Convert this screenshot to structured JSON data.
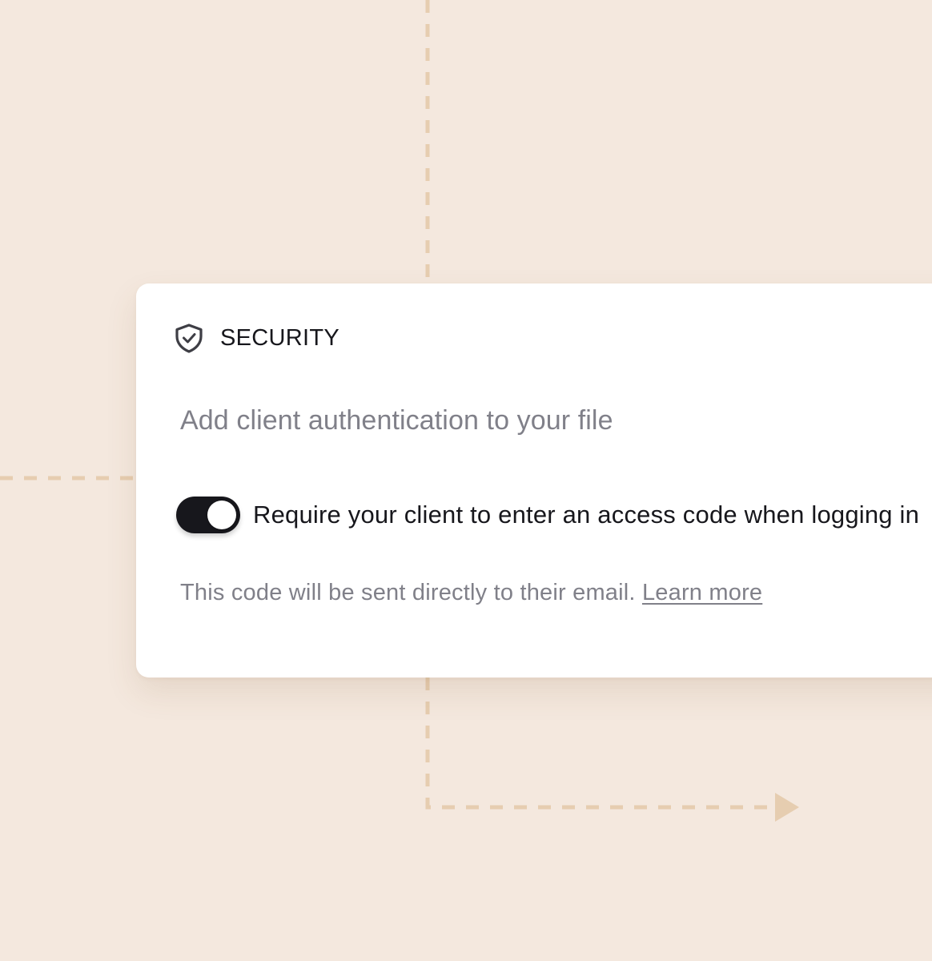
{
  "colors": {
    "background": "#f4e8de",
    "connector": "#e6cdb0",
    "card": "#ffffff",
    "toggle_on": "#17171c",
    "text_primary": "#17171c",
    "text_muted": "#808089"
  },
  "security": {
    "icon": "shield-check-icon",
    "title": "SECURITY",
    "subtitle": "Add client authentication to your file",
    "access_code_toggle": {
      "checked": true,
      "label": "Require your client to enter an access code when logging in"
    },
    "helper_text": "This code will be sent directly to their email.",
    "learn_more_label": "Learn more"
  }
}
